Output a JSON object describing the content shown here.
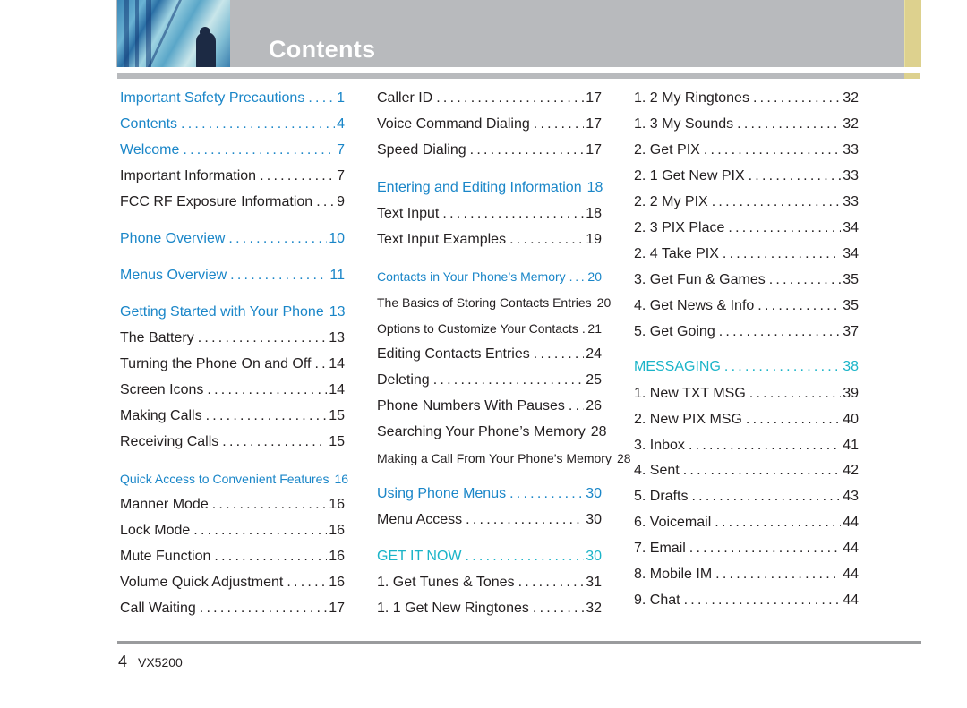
{
  "header": {
    "title": "Contents",
    "accent_color": "#ddd18e",
    "bar_color": "#b8babd"
  },
  "colors": {
    "section_blue": "#1a86c8",
    "section_teal": "#1ab4c8",
    "text": "#231f20"
  },
  "columns": [
    {
      "entries": [
        {
          "label": "Important Safety Precautions",
          "page": "1",
          "style": "blue"
        },
        {
          "label": "Contents",
          "page": "4",
          "style": "blue"
        },
        {
          "label": "Welcome",
          "page": "7",
          "style": "blue"
        },
        {
          "label": "Important Information",
          "page": "7",
          "style": "normal"
        },
        {
          "label": "FCC RF Exposure Information",
          "page": "9",
          "style": "normal"
        },
        {
          "label": "Phone Overview",
          "page": "10",
          "style": "blue"
        },
        {
          "label": "Menus Overview",
          "page": "11",
          "style": "blue"
        },
        {
          "label": "Getting Started with Your Phone",
          "page": "13",
          "style": "blue"
        },
        {
          "label": "The Battery",
          "page": "13",
          "style": "normal"
        },
        {
          "label": "Turning the Phone On and Off",
          "page": "14",
          "style": "normal"
        },
        {
          "label": "Screen Icons",
          "page": "14",
          "style": "normal"
        },
        {
          "label": "Making Calls",
          "page": "15",
          "style": "normal"
        },
        {
          "label": "Receiving Calls",
          "page": "15",
          "style": "normal"
        },
        {
          "label": "Quick Access to Convenient Features",
          "page": "16",
          "style": "blue-small"
        },
        {
          "label": "Manner Mode",
          "page": "16",
          "style": "normal"
        },
        {
          "label": "Lock Mode",
          "page": "16",
          "style": "normal"
        },
        {
          "label": "Mute Function",
          "page": "16",
          "style": "normal"
        },
        {
          "label": "Volume Quick Adjustment",
          "page": "16",
          "style": "normal"
        },
        {
          "label": "Call Waiting",
          "page": "17",
          "style": "normal"
        }
      ]
    },
    {
      "entries": [
        {
          "label": "Caller ID",
          "page": "17",
          "style": "normal"
        },
        {
          "label": "Voice Command Dialing",
          "page": "17",
          "style": "normal"
        },
        {
          "label": "Speed Dialing",
          "page": "17",
          "style": "normal"
        },
        {
          "label": "Entering and Editing Information",
          "page": "18",
          "style": "blue"
        },
        {
          "label": "Text Input",
          "page": "18",
          "style": "normal"
        },
        {
          "label": "Text Input Examples",
          "page": "19",
          "style": "normal"
        },
        {
          "label": "Contacts in Your Phone’s Memory",
          "page": "20",
          "style": "blue-small"
        },
        {
          "label": "The Basics of Storing Contacts Entries",
          "page": "20",
          "style": "small"
        },
        {
          "label": "Options to Customize Your Contacts",
          "page": "21",
          "style": "small"
        },
        {
          "label": "Editing Contacts Entries",
          "page": "24",
          "style": "normal"
        },
        {
          "label": "Deleting",
          "page": "25",
          "style": "normal"
        },
        {
          "label": "Phone Numbers With Pauses",
          "page": "26",
          "style": "normal"
        },
        {
          "label": "Searching Your Phone’s Memory",
          "page": "28",
          "style": "normal"
        },
        {
          "label": "Making a Call From Your Phone’s Memory",
          "page": "28",
          "style": "small"
        },
        {
          "label": "Using Phone Menus",
          "page": "30",
          "style": "blue"
        },
        {
          "label": "Menu Access",
          "page": "30",
          "style": "normal"
        },
        {
          "label": "GET IT NOW",
          "page": "30",
          "style": "teal"
        },
        {
          "label": "1. Get Tunes & Tones",
          "page": "31",
          "style": "normal"
        },
        {
          "label": "1. 1 Get New Ringtones",
          "page": "32",
          "style": "normal"
        }
      ]
    },
    {
      "entries": [
        {
          "label": "1. 2 My Ringtones",
          "page": "32",
          "style": "normal"
        },
        {
          "label": "1. 3 My Sounds",
          "page": "32",
          "style": "normal"
        },
        {
          "label": "2. Get PIX",
          "page": "33",
          "style": "normal"
        },
        {
          "label": "2. 1 Get New PIX",
          "page": "33",
          "style": "normal"
        },
        {
          "label": "2. 2 My PIX",
          "page": "33",
          "style": "normal"
        },
        {
          "label": "2. 3 PIX Place",
          "page": "34",
          "style": "normal"
        },
        {
          "label": "2. 4 Take PIX",
          "page": "34",
          "style": "normal"
        },
        {
          "label": "3. Get Fun & Games",
          "page": "35",
          "style": "normal"
        },
        {
          "label": "4. Get News & Info",
          "page": "35",
          "style": "normal"
        },
        {
          "label": "5. Get Going",
          "page": "37",
          "style": "normal"
        },
        {
          "label": "MESSAGING",
          "page": "38",
          "style": "teal"
        },
        {
          "label": "1. New TXT MSG",
          "page": "39",
          "style": "normal"
        },
        {
          "label": "2. New PIX MSG",
          "page": "40",
          "style": "normal"
        },
        {
          "label": "3.  Inbox",
          "page": "41",
          "style": "normal"
        },
        {
          "label": "4. Sent",
          "page": "42",
          "style": "normal"
        },
        {
          "label": "5. Drafts",
          "page": "43",
          "style": "normal"
        },
        {
          "label": "6. Voicemail",
          "page": "44",
          "style": "normal"
        },
        {
          "label": "7. Email",
          "page": "44",
          "style": "normal"
        },
        {
          "label": "8. Mobile IM",
          "page": "44",
          "style": "normal"
        },
        {
          "label": "9. Chat",
          "page": "44",
          "style": "normal"
        }
      ]
    }
  ],
  "footer": {
    "page_number": "4",
    "model": "VX5200"
  }
}
